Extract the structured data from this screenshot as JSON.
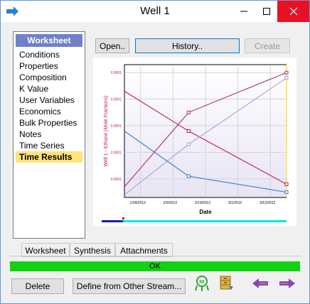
{
  "window": {
    "title": "Well 1"
  },
  "sidebar": {
    "header": "Worksheet",
    "items": [
      {
        "label": "Conditions"
      },
      {
        "label": "Properties"
      },
      {
        "label": "Composition"
      },
      {
        "label": "K Value"
      },
      {
        "label": "User Variables"
      },
      {
        "label": "Economics"
      },
      {
        "label": "Bulk Properties"
      },
      {
        "label": "Notes"
      },
      {
        "label": "Time Series"
      },
      {
        "label": "Time Results",
        "active": true
      }
    ]
  },
  "toolbar": {
    "open_label": "Open..",
    "history_label": "History..",
    "create_label": "Create"
  },
  "chart_data": {
    "type": "line",
    "xlabel": "Date",
    "ylabel": "Well 1 - Ethane (Mole Fractions)",
    "x_ticks": [
      "1/29/2012",
      "2/9/2012",
      "2/19/2012",
      "3/1/2012",
      "3/12/2012"
    ],
    "y_ticks": [
      "0.0001",
      "0.0001",
      "0.0001",
      "0.0001",
      "0.0001"
    ],
    "x": [
      "1/29/2012",
      "2/19/2012",
      "3/22/2012"
    ],
    "series": [
      {
        "color": "#c2185b",
        "values": [
          0.00012,
          0.000105,
          8.5e-05
        ]
      },
      {
        "color": "#9fa0e0",
        "values": [
          8.1e-05,
          0.0001,
          0.000125
        ]
      },
      {
        "color": "#3a7dc9",
        "values": [
          0.000105,
          8.8e-05,
          8.2e-05
        ]
      },
      {
        "color": "#a8326e",
        "values": [
          8.4e-05,
          0.000112,
          0.000127
        ]
      }
    ],
    "grid": true
  },
  "tabs": [
    {
      "label": "Worksheet",
      "active": true
    },
    {
      "label": "Synthesis"
    },
    {
      "label": "Attachments"
    }
  ],
  "status": {
    "text": "OK"
  },
  "footer": {
    "delete_label": "Delete",
    "define_label": "Define from Other Stream..."
  },
  "colors": {
    "status_ok": "#13d013",
    "sidebar_header": "#7081c6",
    "active_item": "#ffe27a"
  }
}
